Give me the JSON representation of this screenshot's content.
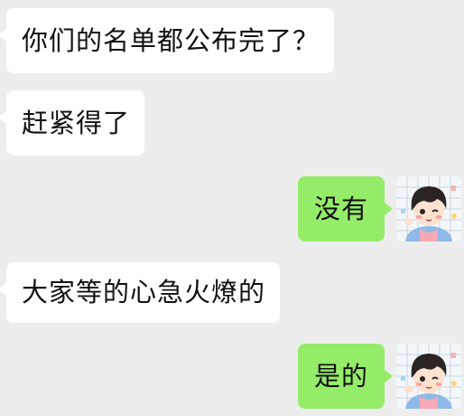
{
  "chat": {
    "messages": [
      {
        "side": "received",
        "text": "你们的名单都公布完了？"
      },
      {
        "side": "received",
        "text": "赶紧得了"
      },
      {
        "side": "sent",
        "text": "没有"
      },
      {
        "side": "received",
        "text": "大家等的心急火燎的"
      },
      {
        "side": "sent",
        "text": "是的"
      }
    ]
  },
  "colors": {
    "background": "#ededed",
    "received_bubble": "#ffffff",
    "sent_bubble": "#95ec69",
    "text": "#111111"
  },
  "icons": {
    "self_avatar": "cartoon-boy-avatar"
  }
}
